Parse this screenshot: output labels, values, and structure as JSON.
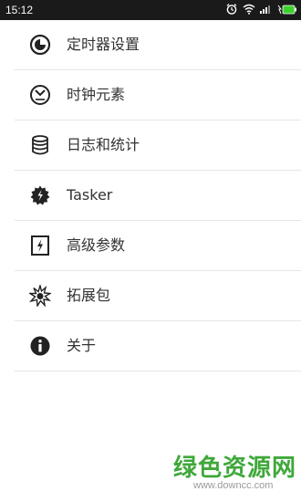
{
  "status_bar": {
    "time": "15:12",
    "icons": [
      "alarm-icon",
      "wifi-icon",
      "signal-icon",
      "battery-charging-icon"
    ]
  },
  "menu": {
    "items": [
      {
        "label": "定时器设置",
        "icon": "timer-settings-icon"
      },
      {
        "label": "时钟元素",
        "icon": "clock-icon"
      },
      {
        "label": "日志和统计",
        "icon": "database-icon"
      },
      {
        "label": "Tasker",
        "icon": "tasker-gear-icon"
      },
      {
        "label": "高级参数",
        "icon": "flash-box-icon"
      },
      {
        "label": "拓展包",
        "icon": "extension-burst-icon"
      },
      {
        "label": "关于",
        "icon": "info-icon"
      }
    ]
  },
  "watermark": {
    "text": "绿色资源网",
    "url": "www.downcc.com",
    "color": "#3fa83a"
  }
}
